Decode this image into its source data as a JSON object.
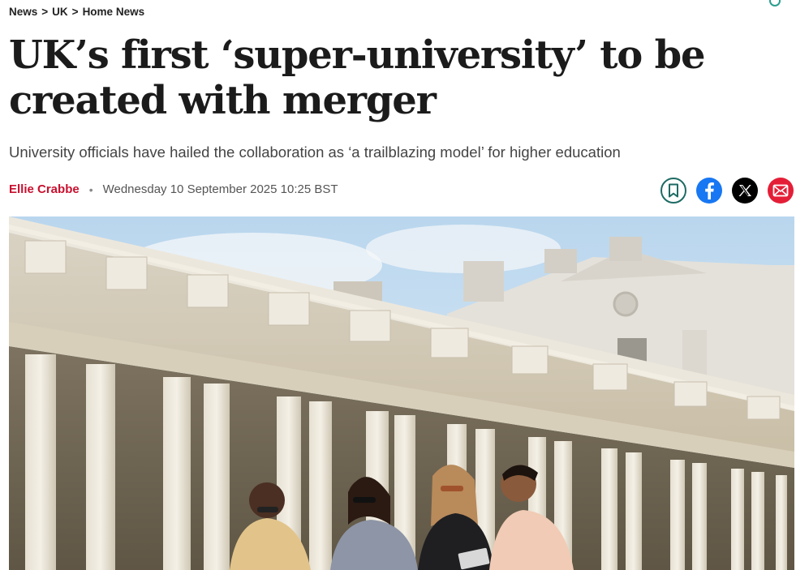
{
  "breadcrumb": {
    "items": [
      "News",
      "UK",
      "Home News"
    ],
    "separator": ">"
  },
  "article": {
    "headline": "UK’s first ‘super-university’ to be created with merger",
    "standfirst": "University officials have hailed the collaboration as ‘a trailblazing model’ for higher education",
    "author": "Ellie Crabbe",
    "date": "Wednesday 10 September 2025 10:25 BST"
  },
  "share": {
    "icons": [
      "bookmark-icon",
      "facebook-icon",
      "x-icon",
      "email-icon"
    ],
    "colors": {
      "bookmark": "#1e6b63",
      "facebook": "#1877f2",
      "x": "#000000",
      "email": "#e41e37"
    }
  },
  "theme": {
    "accent": "#c8102e"
  }
}
